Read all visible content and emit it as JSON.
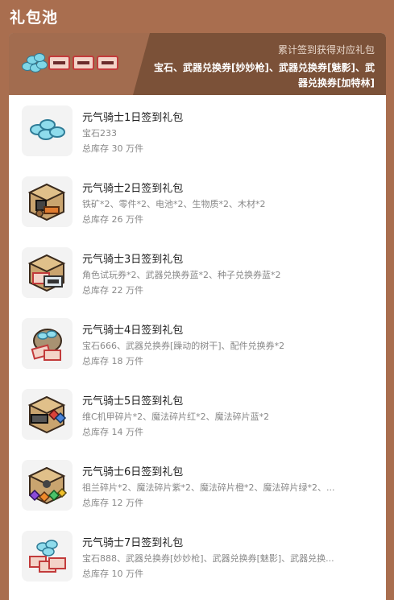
{
  "page": {
    "title": "礼包池"
  },
  "banner": {
    "subtitle": "累计签到获得对应礼包",
    "line1": "宝石、武器兑换券[妙妙枪]、武器兑换券[魅影]、武",
    "line2": "器兑换券[加特林]"
  },
  "items": [
    {
      "title": "元气骑士1日签到礼包",
      "desc": "宝石233",
      "stock": "总库存 30 万件",
      "icon": "gems-icon"
    },
    {
      "title": "元气骑士2日签到礼包",
      "desc": "铁矿*2、零件*2、电池*2、生物质*2、木材*2",
      "stock": "总库存 26 万件",
      "icon": "materials-box-icon"
    },
    {
      "title": "元气骑士3日签到礼包",
      "desc": "角色试玩券*2、武器兑换券蓝*2、种子兑换券蓝*2",
      "stock": "总库存 22 万件",
      "icon": "tickets-box-icon"
    },
    {
      "title": "元气骑士4日签到礼包",
      "desc": "宝石666、武器兑换券[躁动的树干]、配件兑换券*2",
      "stock": "总库存 18 万件",
      "icon": "gem-bag-icon"
    },
    {
      "title": "元气骑士5日签到礼包",
      "desc": "维C机甲碎片*2、魔法碎片红*2、魔法碎片蓝*2",
      "stock": "总库存 14 万件",
      "icon": "fragments-box-icon"
    },
    {
      "title": "元气骑士6日签到礼包",
      "desc": "祖兰碎片*2、魔法碎片紫*2、魔法碎片橙*2、魔法碎片绿*2、...",
      "stock": "总库存 12 万件",
      "icon": "magic-fragments-box-icon"
    },
    {
      "title": "元气骑士7日签到礼包",
      "desc": "宝石888、武器兑换券[妙妙枪]、武器兑换券[魅影]、武器兑换...",
      "stock": "总库存 10 万件",
      "icon": "gems-tickets-icon"
    }
  ]
}
